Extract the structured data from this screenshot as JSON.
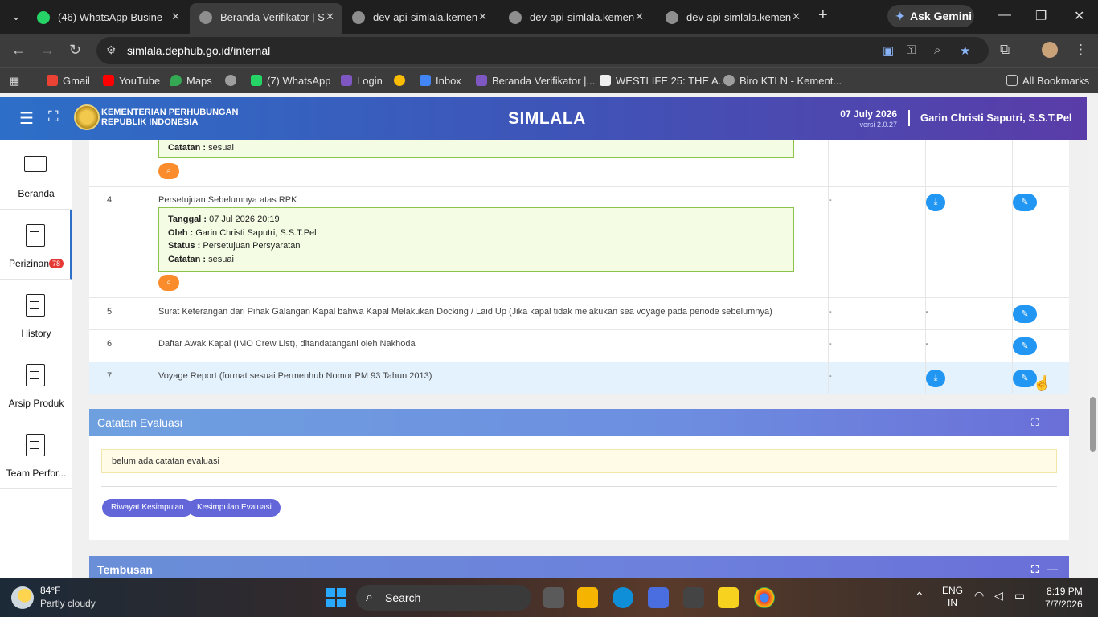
{
  "browser": {
    "tabs": [
      {
        "title": "(46) WhatsApp Busines",
        "favicon_color": "#25d366",
        "active": false
      },
      {
        "title": "Beranda Verifikator | Si",
        "favicon_color": "#8e8e8e",
        "active": true
      },
      {
        "title": "dev-api-simlala.kemen",
        "favicon_color": "#8e8e8e",
        "active": false
      },
      {
        "title": "dev-api-simlala.kemen",
        "favicon_color": "#8e8e8e",
        "active": false
      },
      {
        "title": "dev-api-simlala.kemen",
        "favicon_color": "#8e8e8e",
        "active": false
      }
    ],
    "ask_gemini": "Ask Gemini",
    "url": "simlala.dephub.go.id/internal",
    "bookmarks": [
      {
        "label": "Gmail",
        "icon_color": "#ea4335"
      },
      {
        "label": "YouTube",
        "icon_color": "#ff0000"
      },
      {
        "label": "Maps",
        "icon_color": "#34a853"
      },
      {
        "label": "",
        "icon_color": "#9e9e9e"
      },
      {
        "label": "(7) WhatsApp",
        "icon_color": "#25d366"
      },
      {
        "label": "Login",
        "icon_color": "#7e57c2"
      },
      {
        "label": "",
        "icon_color": "#fbbc04"
      },
      {
        "label": "Inbox",
        "icon_color": "#4285f4"
      },
      {
        "label": "Beranda Verifikator |...",
        "icon_color": "#7e57c2"
      },
      {
        "label": "WESTLIFE 25: THE A...",
        "icon_color": "#eeeeee"
      },
      {
        "label": "Biro KTLN - Kement...",
        "icon_color": "#9e9e9e"
      }
    ],
    "all_bookmarks": "All Bookmarks"
  },
  "header": {
    "ministry_line1": "KEMENTERIAN PERHUBUNGAN",
    "ministry_line2": "REPUBLIK INDONESIA",
    "app_title": "SIMLALA",
    "date": "07 July 2026",
    "version": "versi 2.0.27",
    "user": "Garin Christi Saputri, S.S.T.Pel"
  },
  "sidebar": [
    {
      "label": "Beranda",
      "icon": "monitor-icon",
      "badge": ""
    },
    {
      "label": "Perizinan",
      "icon": "document-icon",
      "badge": "78"
    },
    {
      "label": "History",
      "icon": "document-icon",
      "badge": ""
    },
    {
      "label": "Arsip Produk",
      "icon": "document-icon",
      "badge": ""
    },
    {
      "label": "Team Perfor...",
      "icon": "document-icon",
      "badge": ""
    }
  ],
  "documents": {
    "row3_note": {
      "catatan_label": "Catatan :",
      "catatan": "sesuai"
    },
    "rows": [
      {
        "no": "4",
        "description": "Persetujuan Sebelumnya atas RPK",
        "col1": "-",
        "has_download": true,
        "col2": "",
        "note": {
          "tanggal_label": "Tanggal :",
          "tanggal": "07 Jul 2026 20:19",
          "oleh_label": "Oleh :",
          "oleh": "Garin Christi Saputri, S.S.T.Pel",
          "status_label": "Status :",
          "status": "Persetujuan Persyaratan",
          "catatan_label": "Catatan :",
          "catatan": "sesuai"
        }
      },
      {
        "no": "5",
        "description": "Surat Keterangan dari Pihak Galangan Kapal bahwa Kapal Melakukan Docking / Laid Up (Jika kapal tidak melakukan sea voyage pada periode sebelumnya)",
        "col1": "-",
        "col2": "-",
        "has_download": false
      },
      {
        "no": "6",
        "description": "Daftar Awak Kapal (IMO Crew List), ditandatangani oleh Nakhoda",
        "col1": "-",
        "col2": "-",
        "has_download": false
      },
      {
        "no": "7",
        "description": "Voyage Report (format sesuai Permenhub Nomor PM 93 Tahun 2013)",
        "col1": "-",
        "col2": "",
        "has_download": true
      }
    ]
  },
  "catatan_evaluasi": {
    "title": "Catatan Evaluasi",
    "empty_text": "belum ada catatan evaluasi",
    "btn_riwayat": "Riwayat Kesimpulan",
    "btn_kesimpulan": "Kesimpulan Evaluasi"
  },
  "tembusan": {
    "title": "Tembusan"
  },
  "taskbar": {
    "temp": "84°F",
    "weather": "Partly cloudy",
    "search": "Search",
    "lang1": "ENG",
    "lang2": "IN",
    "time": "8:19 PM",
    "date": "7/7/2026"
  }
}
